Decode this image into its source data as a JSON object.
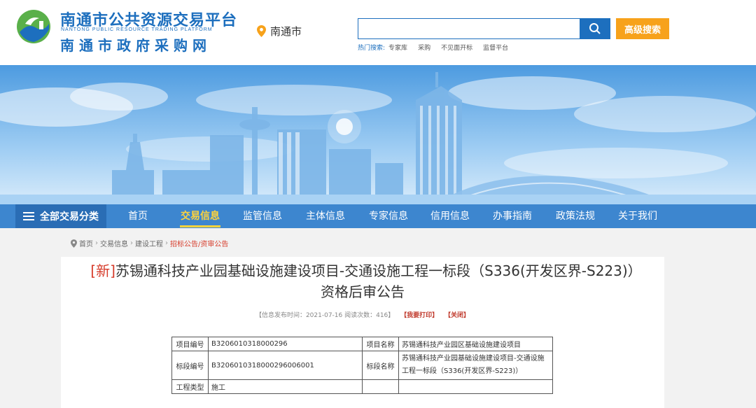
{
  "header": {
    "brand_cn": "南通市公共资源交易平台",
    "brand_en": "NANTONG PUBLIC RESOURCE TRADING PLATFORM",
    "brand_cn2": "南通市政府采购网",
    "city": "南通市",
    "search_placeholder": "",
    "advanced_search_label": "高级搜索",
    "hot_label": "热门搜索:",
    "hot_items": [
      "专家库",
      "采购",
      "不见面开标",
      "监督平台"
    ]
  },
  "nav": {
    "all_label": "全部交易分类",
    "items": [
      "首页",
      "交易信息",
      "监管信息",
      "主体信息",
      "专家信息",
      "信用信息",
      "办事指南",
      "政策法规",
      "关于我们"
    ],
    "active_index": 1
  },
  "breadcrumb": [
    "首页",
    "交易信息",
    "建设工程",
    "招标公告/资审公告"
  ],
  "article": {
    "new_tag": "[新]",
    "title": "苏锡通科技产业园基础设施建设项目-交通设施工程一标段（S336(开发区界-S223)）资格后审公告",
    "meta": "【信息发布时间：2021-07-16 阅读次数：416】",
    "print_label": "【我要打印】",
    "close_label": "【关闭】",
    "table": {
      "project_code_label": "项目编号",
      "project_code": "B3206010318000296",
      "project_name_label": "项目名称",
      "project_name": "苏锡通科技产业园区基础设施建设项目",
      "section_code_label": "标段编号",
      "section_code": "B3206010318000296006001",
      "section_name_label": "标段名称",
      "section_name": "苏锡通科技产业园基础设施建设项目-交通设施工程一标段（S336(开发区界-S223)）",
      "type_label": "工程类型",
      "type": "施工"
    }
  },
  "colors": {
    "brand_blue": "#1d6fbe",
    "nav_blue": "#3d86cf",
    "accent_orange": "#f7a21b",
    "active_yellow": "#ffd33b",
    "new_red": "#d63b2a"
  }
}
